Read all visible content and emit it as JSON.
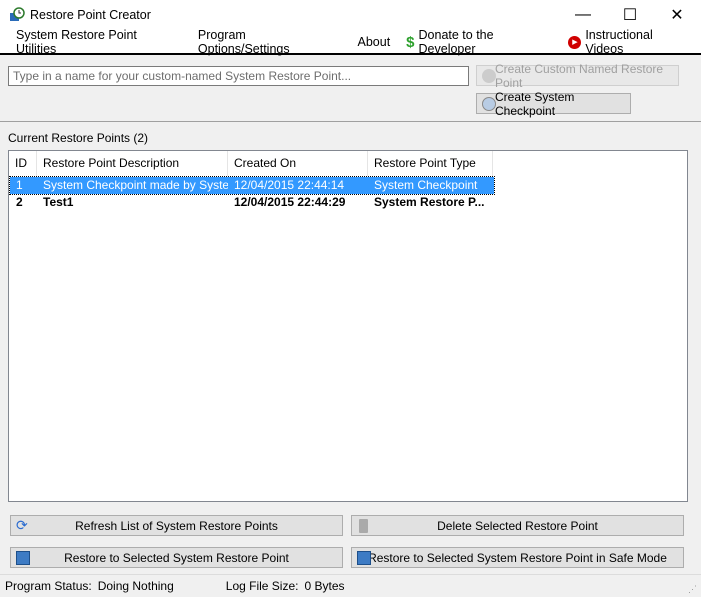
{
  "window": {
    "title": "Restore Point Creator",
    "minimize": "—",
    "maximize": "☐",
    "close": "✕"
  },
  "menu": [
    {
      "label": "System Restore Point Utilities"
    },
    {
      "label": "Program Options/Settings"
    },
    {
      "label": "About"
    },
    {
      "label": "Donate to the Developer",
      "icon": "dollar-icon"
    },
    {
      "label": "Instructional Videos",
      "icon": "play-icon"
    }
  ],
  "name_input": {
    "placeholder": "Type in a name for your custom-named System Restore Point...",
    "value": ""
  },
  "buttons": {
    "create_custom": "Create Custom Named Restore Point",
    "create_checkpoint": "Create System Checkpoint",
    "refresh": "Refresh List of System Restore Points",
    "delete": "Delete Selected Restore Point",
    "restore": "Restore to Selected System Restore Point",
    "restore_safe": "Restore to Selected System Restore Point in Safe Mode"
  },
  "list": {
    "label": "Current Restore Points (2)",
    "columns": [
      "ID",
      "Restore Point Description",
      "Created On",
      "Restore Point Type"
    ],
    "rows": [
      [
        "1",
        "System Checkpoint made by Syste...",
        "12/04/2015 22:44:14",
        "System Checkpoint"
      ],
      [
        "2",
        "Test1",
        "12/04/2015 22:44:29",
        "System Restore P..."
      ]
    ]
  },
  "status": {
    "program_label": "Program Status:",
    "program_value": "Doing Nothing",
    "log_label": "Log File Size:",
    "log_value": "0 Bytes"
  },
  "colors": {
    "selection": "#3399ff",
    "accent_green": "#2ca02c",
    "accent_red": "#d00000"
  }
}
